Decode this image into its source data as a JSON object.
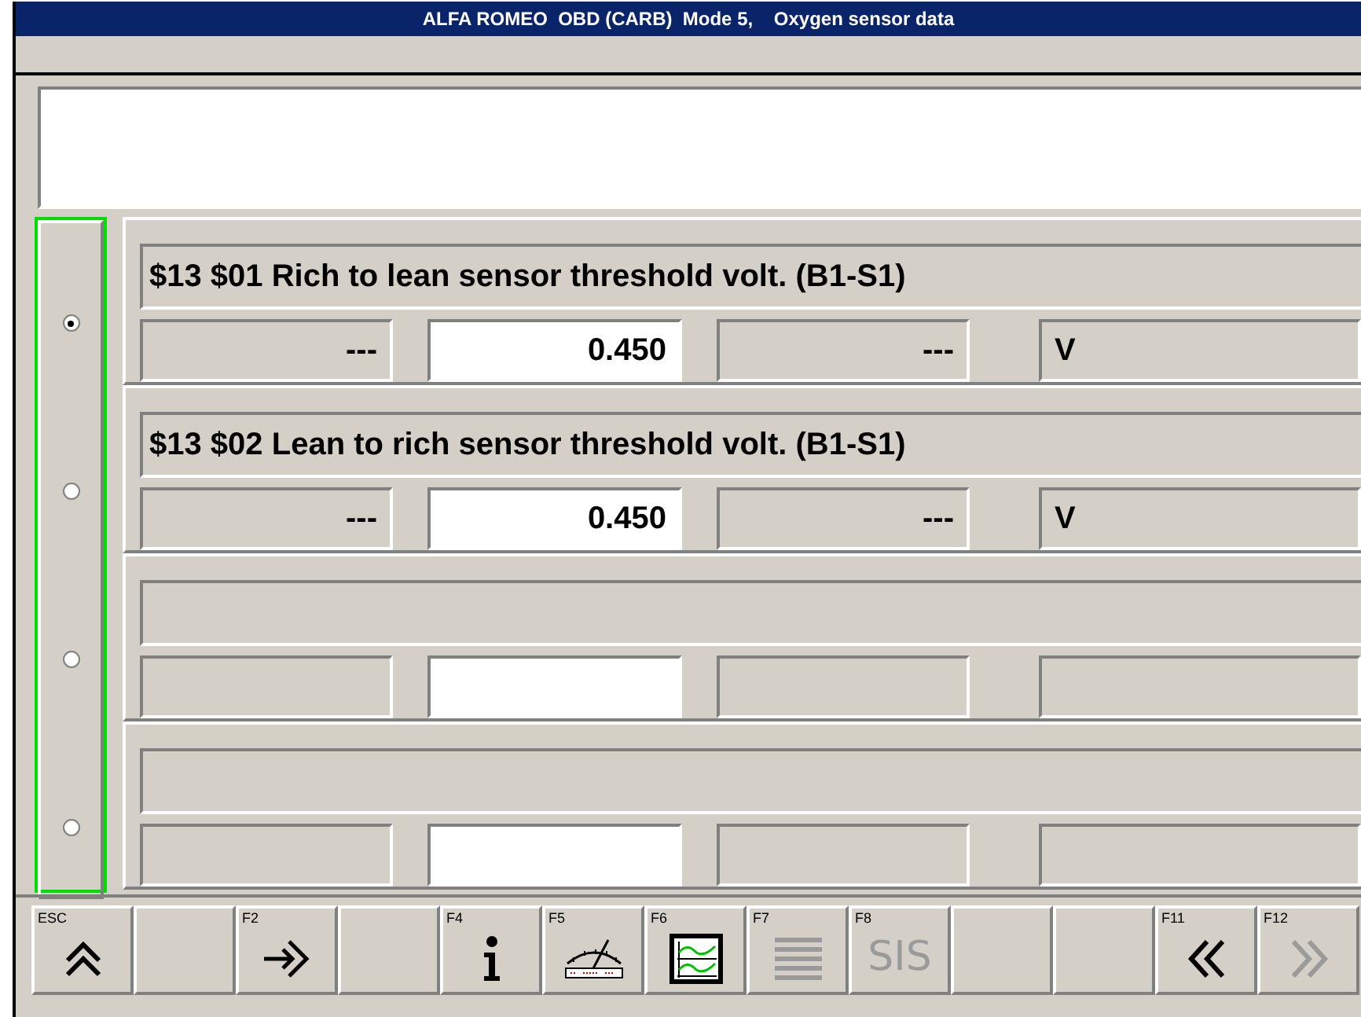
{
  "window": {
    "title": "ALFA ROMEO  OBD (CARB)  Mode 5,    Oxygen sensor data"
  },
  "rows": [
    {
      "selected": true,
      "label": "$13 $01 Rich to lean sensor threshold volt. (B1-S1)",
      "min": "---",
      "value": "0.450",
      "max": "---",
      "unit": "V"
    },
    {
      "selected": false,
      "label": "$13 $02 Lean to rich sensor threshold volt. (B1-S1)",
      "min": "---",
      "value": "0.450",
      "max": "---",
      "unit": "V"
    },
    {
      "selected": false
    },
    {
      "selected": false
    }
  ],
  "toolbar": [
    {
      "key": "ESC",
      "kind": "up",
      "disabled": false
    },
    {
      "kind": "blank"
    },
    {
      "key": "F2",
      "kind": "enter",
      "disabled": false
    },
    {
      "kind": "blank"
    },
    {
      "key": "F4",
      "kind": "info",
      "disabled": false
    },
    {
      "key": "F5",
      "kind": "gauge",
      "disabled": false
    },
    {
      "key": "F6",
      "kind": "chart",
      "disabled": false
    },
    {
      "key": "F7",
      "kind": "list",
      "disabled": true
    },
    {
      "key": "F8",
      "kind": "text",
      "text": "SIS",
      "disabled": true
    },
    {
      "kind": "blank"
    },
    {
      "kind": "blank"
    },
    {
      "key": "F11",
      "kind": "back",
      "disabled": false
    },
    {
      "key": "F12",
      "kind": "forward",
      "disabled": true
    }
  ]
}
